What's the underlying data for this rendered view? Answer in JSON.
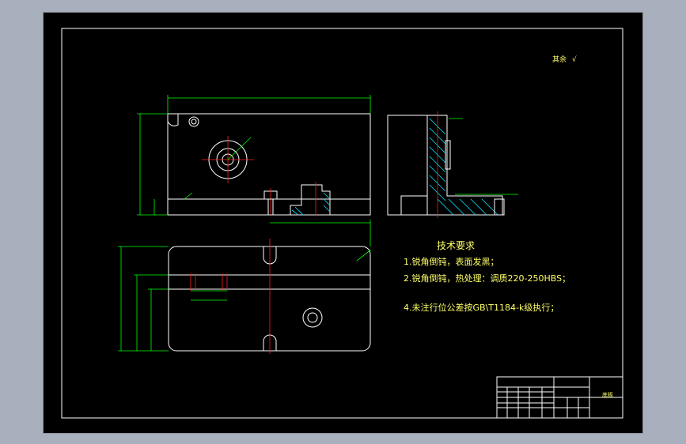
{
  "drawing": {
    "roughness_note": "其余",
    "roughness_symbol": "√",
    "tech_title": "技术要求",
    "tech_items": [
      "1.锐角倒钝，表面发黑；",
      "2.锐角倒钝，热处理：调质220-250HBS；",
      "4.未注行位公差按GB\\T1184-k级执行；"
    ],
    "title_block_name": "底板"
  },
  "colors": {
    "frame": "#ffffff",
    "text": "#ffff66",
    "dimension": "#00ff00",
    "centerline": "#ff2020",
    "hatch": "#00e5ff"
  }
}
